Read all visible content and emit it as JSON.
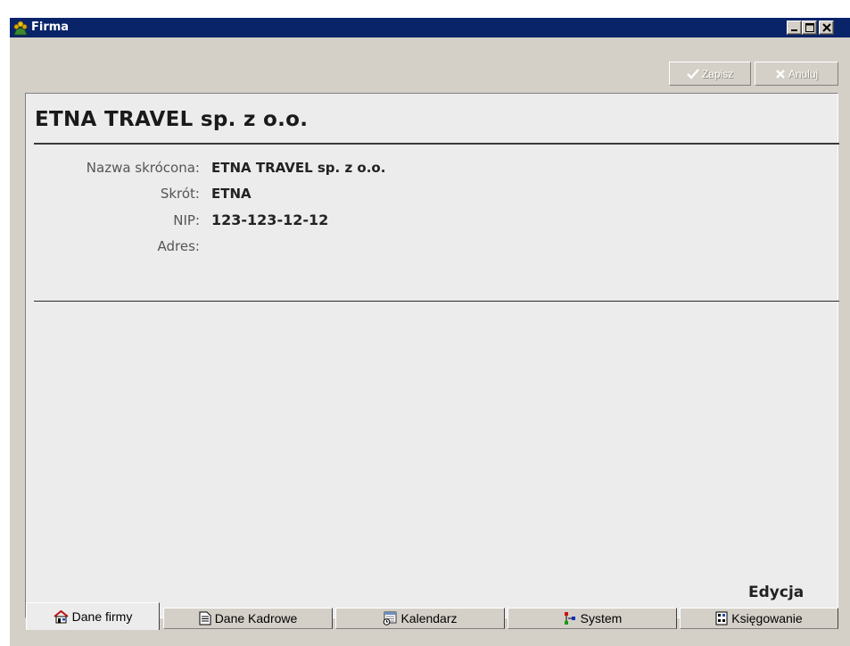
{
  "window": {
    "title": "Firma"
  },
  "toolbar": {
    "save_label": "Zapisz",
    "cancel_label": "Anuluj"
  },
  "company": {
    "name": "ETNA TRAVEL sp. z o.o.",
    "fields": [
      {
        "label": "Nazwa skrócona:",
        "value": "ETNA TRAVEL sp. z o.o."
      },
      {
        "label": "Skrót:",
        "value": "ETNA"
      },
      {
        "label": "NIP:",
        "value": "123-123-12-12"
      },
      {
        "label": "Adres:",
        "value": ""
      }
    ]
  },
  "mode": "Edycja",
  "tabs": [
    {
      "label": "Dane firmy",
      "icon": "house-icon",
      "active": true
    },
    {
      "label": "Dane Kadrowe",
      "icon": "document-icon",
      "active": false
    },
    {
      "label": "Kalendarz",
      "icon": "calendar-icon",
      "active": false
    },
    {
      "label": "System",
      "icon": "system-icon",
      "active": false
    },
    {
      "label": "Księgowanie",
      "icon": "calculator-icon",
      "active": false
    }
  ],
  "colors": {
    "titlebar": "#0a246a",
    "window_bg": "#d4d0c8",
    "panel_bg": "#ececec"
  }
}
